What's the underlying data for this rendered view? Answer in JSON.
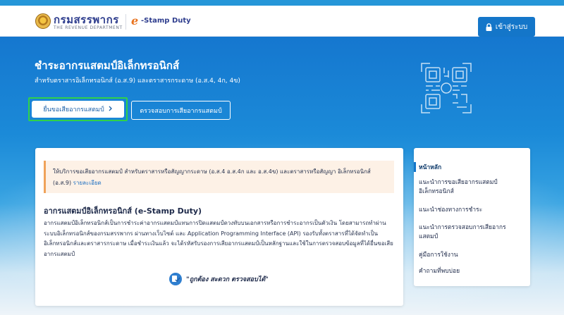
{
  "header": {
    "logo_th": "กรมสรรพากร",
    "logo_en": "THE REVENUE DEPARTMENT",
    "estamp_e": "e",
    "estamp_label": "-Stamp Duty",
    "login_label": "เข้าสู่ระบบ",
    "login_icon": "lock-icon"
  },
  "hero": {
    "title": "ชำระอากรแสตมป์อิเล็กทรอนิกส์",
    "subtitle": "สำหรับตราสารอิเล็กทรอนิกส์ (อ.ส.9) และตราสารกระดาษ (อ.ส.4, 4ก, 4ข)",
    "primary_button": "ยื่นขอเสียอากรแสตมป์",
    "primary_button_icon": "chevron-right-icon",
    "secondary_button": "ตรวจสอบการเสียอากรแสตมป์",
    "decor_icon": "qr-code-icon"
  },
  "notice": {
    "text": "ให้บริการขอเสียอากรแสตมป์ สำหรับตราสารหรือสัญญากระดาษ (อ.ส.4 อ.ส.4ก และ อ.ส.4ข) และตราสารหรือสัญญา อิเล็กทรอนิกส์ (อ.ส.9)",
    "link": "รายละเอียด"
  },
  "content": {
    "title": "อากรแสตมป์อิเล็กทรอนิกส์ (e-Stamp Duty)",
    "body": "อากรแสตมป์อิเล็กทรอนิกส์เป็นการชำระค่าอากรแสตมป์แทนการปิดแสตมป์ดวงทับบนเอกสารหรือการชำระอากรเป็นตัวเงิน โดยสามารถทำผ่านระบบอิเล็กทรอนิกส์ของกรมสรรพากร ผ่านทางเว็บไซต์ และ Application Programming Interface (API) รองรับทั้งตราสารที่ได้จัดทำเป็นอิเล็กทรอนิกส์และตราสารกระดาษ เมื่อชำระเงินแล้ว จะได้รหัสรับรองการเสียอากรแสตมป์เป็นหลักฐานและใช้ในการตรวจสอบข้อมูลที่ได้ยื่นขอเสียอากรแสตมป์",
    "slogan": "\"ถูกต้อง สะดวก ตรวจสอบได้\"",
    "slogan_icon": "check-stamp-icon"
  },
  "sidebar": {
    "items": [
      {
        "label": "หน้าหลัก"
      },
      {
        "label": "แนะนำการขอเสียอากรแสตมป์อิเล็กทรอนิกส์"
      },
      {
        "label": "แนะนำช่องทางการชำระ"
      },
      {
        "label": "แนะนำการตรวจสอบการเสียอากรแสตมป์"
      },
      {
        "label": "คู่มือการใช้งาน"
      },
      {
        "label": "คำถามที่พบบ่อย"
      }
    ]
  },
  "colors": {
    "brand_blue": "#1476c9",
    "highlight_green": "#30d14a",
    "notice_bg": "#fdf1e6"
  }
}
